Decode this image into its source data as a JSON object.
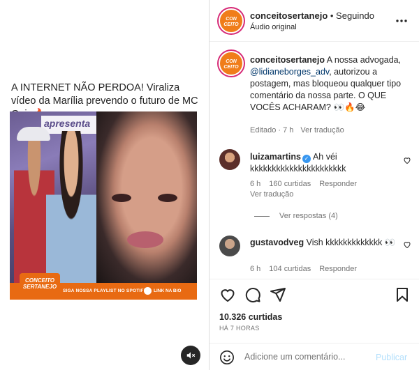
{
  "media": {
    "headline": "A INTERNET NÃO PERDOA! Viraliza vídeo da Marília prevendo o futuro de MC Gui. 🔥",
    "banner_text": "apresenta",
    "footer_logo": "CONCEITO SERTANEJO",
    "footer_playlist": "SIGA NOSSA PLAYLIST NO SPOTIFY",
    "footer_link": "LINK NA BIO"
  },
  "header": {
    "avatar_text": "CON CEITO",
    "username": "conceitosertanejo",
    "separator": " • ",
    "follow_status": "Seguindo",
    "audio": "Áudio original"
  },
  "caption": {
    "username": "conceitosertanejo",
    "text_before": " A nossa advogada, ",
    "mention": "@lidianeborges_adv",
    "text_after": ", autorizou a postagem, mas bloqueou qualquer tipo comentário da nossa parte. O QUE VOCÊS ACHARAM? 👀🔥😂",
    "edited": "Editado · 7 h",
    "translate": "Ver tradução"
  },
  "comments": [
    {
      "username": "luizamartins",
      "text": "Ah véi kkkkkkkkkkkkkkkkkkkkkk",
      "time": "6 h",
      "likes": "160 curtidas",
      "reply": "Responder",
      "translate": "Ver tradução",
      "view_replies": "Ver respostas (4)"
    },
    {
      "username": "gustavodveg",
      "text": "Vish kkkkkkkkkkkkk 👀",
      "time": "6 h",
      "likes": "104 curtidas",
      "reply": "Responder"
    }
  ],
  "actions": {
    "likes": "10.326 curtidas",
    "time_ago": "HÁ 7 HORAS"
  },
  "composer": {
    "placeholder": "Adicione um comentário...",
    "publish": "Publicar"
  },
  "colors": {
    "brand_orange": "#e86a12",
    "link_blue": "#00376b",
    "muted": "#737373",
    "publish_disabled": "#b2dffc"
  }
}
